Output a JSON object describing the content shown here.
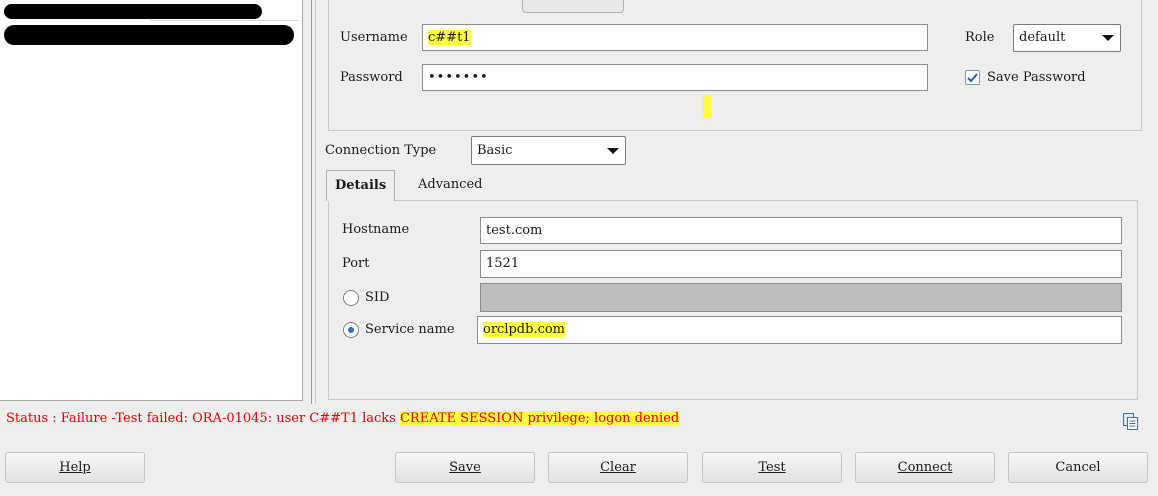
{
  "credentials": {
    "username_label": "Username",
    "username_value": "c##t1",
    "password_label": "Password",
    "password_value": "•••••••",
    "role_label": "Role",
    "role_value": "default",
    "save_password_label": "Save Password",
    "save_password_checked": true
  },
  "connection": {
    "type_label": "Connection Type",
    "type_value": "Basic"
  },
  "tabs": [
    {
      "label": "Details"
    },
    {
      "label": "Advanced"
    }
  ],
  "details": {
    "hostname_label": "Hostname",
    "hostname_value": "test.com",
    "port_label": "Port",
    "port_value": "1521",
    "sid_label": "SID",
    "sid_value": "",
    "service_name_label": "Service name",
    "service_name_value": "orclpdb.com"
  },
  "status": {
    "prefix": "Status : Failure -Test failed: ORA-01045: user C##T1 lacks ",
    "highlight": "CREATE SESSION privilege; logon denied"
  },
  "buttons": {
    "help": "Help",
    "save": "Save",
    "clear": "Clear",
    "test": "Test",
    "connect": "Connect",
    "cancel": "Cancel"
  },
  "colors": {
    "highlight": "#ffff3c",
    "status_error": "#e00000",
    "radio_accent": "#2d6bd6"
  },
  "icons": [
    "checkmark-icon",
    "dropdown-arrow-icon",
    "radio-selected-icon",
    "copy-status-icon"
  ]
}
